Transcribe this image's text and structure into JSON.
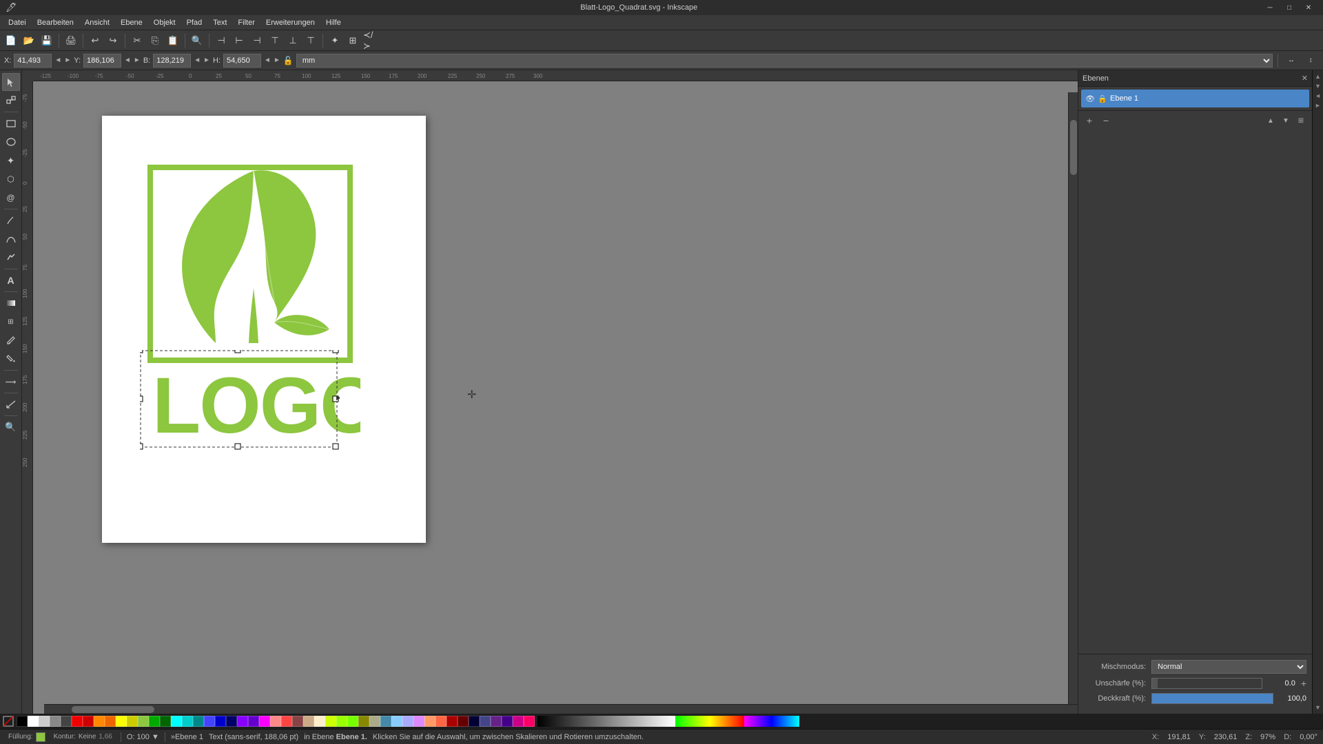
{
  "titlebar": {
    "title": "Blatt-Logo_Quadrat.svg - Inkscape",
    "minimize": "─",
    "maximize": "□",
    "close": "✕"
  },
  "menubar": {
    "items": [
      "Datei",
      "Bearbeiten",
      "Ansicht",
      "Ebene",
      "Objekt",
      "Pfad",
      "Text",
      "Filter",
      "Erweiterungen",
      "Hilfe"
    ]
  },
  "toolbar2": {
    "x_label": "X:",
    "x_value": "41,493",
    "y_label": "Y:",
    "y_value": "186,106",
    "b_label": "B:",
    "b_value": "128,219",
    "h_label": "H:",
    "h_value": "54,650",
    "unit": "mm"
  },
  "canvas": {
    "zoom": "97%"
  },
  "layers_panel": {
    "title": "Ebenen",
    "layer1": {
      "name": "Ebene 1",
      "visible": true,
      "locked": false
    }
  },
  "blend": {
    "mischmode_label": "Mischmodus:",
    "mischmode_value": "Normal",
    "unschaerfe_label": "Unschärfe (%):",
    "unschaerfe_value": "0.0",
    "deckkraft_label": "Deckkraft (%):",
    "deckkraft_value": "100,0"
  },
  "statusbar": {
    "layer_prefix": "»",
    "layer_name": "Ebene 1",
    "type_label": "Text",
    "type_detail": "(sans-serif, 188,06 pt)",
    "context_msg": "in Ebene",
    "layer_name2": "Ebene 1.",
    "hint": "Klicken Sie auf die Auswahl, um zwischen Skalieren und Rotieren umzuschalten.",
    "x_label": "X:",
    "x_val": "191,81",
    "y_label": "Y:",
    "y_val": "230,61",
    "z_label": "Z:",
    "z_val": "97%",
    "d_label": "D:",
    "d_val": "0,00°"
  },
  "fill_info": {
    "filling_label": "Füllung:",
    "stroke_label": "Kontur:",
    "stroke_value": "Keine",
    "stroke_width": "1,66"
  },
  "colors": {
    "logo_green": "#8dc63f",
    "logo_bright_green": "#a4d82f",
    "selection_color": "#4a85c8"
  }
}
